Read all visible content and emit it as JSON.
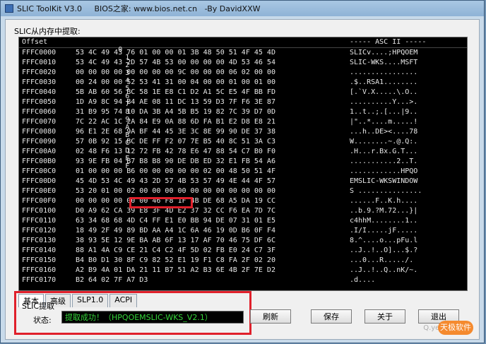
{
  "window": {
    "title": "SLIC ToolKit V3.0     BIOS之家: www.bios.net.cn   -By DavidXXW"
  },
  "memory_section": {
    "label": "SLIC从内存中提取:"
  },
  "hex_view": {
    "header": {
      "offset": "Offset",
      "cols": [
        "0",
        "1",
        "2",
        "3",
        "4",
        "5",
        "6",
        "7",
        "8",
        "9",
        "A",
        "B",
        "C",
        "D",
        "E",
        "F"
      ],
      "ascii": "----- ASC II -----"
    },
    "rows": [
      {
        "addr": "FFFC0000",
        "bytes": "53 4C 49 43 76 01 00 00 01 3B 48 50 51 4F 45 4D",
        "ascii": "SLICv....;HPQOEM"
      },
      {
        "addr": "FFFC0010",
        "bytes": "53 4C 49 43 2D 57 4B 53 00 00 00 00 4D 53 46 54",
        "ascii": "SLIC-WKS....MSFT"
      },
      {
        "addr": "FFFC0020",
        "bytes": "00 00 00 00 00 00 00 00 9C 00 00 00 06 02 00 00",
        "ascii": "................"
      },
      {
        "addr": "FFFC0030",
        "bytes": "00 24 00 00 52 53 41 31 00 04 00 00 01 00 01 00",
        "ascii": ".$..RSA1........"
      },
      {
        "addr": "FFFC0040",
        "bytes": "5B AB 60 56 BC 58 1E E8 C1 D2 A1 5C E5 4F BB FD",
        "ascii": "[.`V.X.....\\.O.."
      },
      {
        "addr": "FFFC0050",
        "bytes": "1D A9 8C 94 B4 AE 08 11 DC 13 59 D3 7F F6 3E 87",
        "ascii": "..........Y...>."
      },
      {
        "addr": "FFFC0060",
        "bytes": "31 B9 95 74 10 DA 3B A4 5B B5 19 82 7C 39 D7 0D",
        "ascii": "1..t..;.[...|9.."
      },
      {
        "addr": "FFFC0070",
        "bytes": "7C 22 AC 1C 2A 84 E9 0A 88 6D FA B1 E2 D8 E8 21",
        "ascii": "|\"..*....m.....!"
      },
      {
        "addr": "FFFC0080",
        "bytes": "96 E1 2E 68 9A BF 44 45 3E 3C 8E 99 90 DE 37 38",
        "ascii": "...h..DE><....78"
      },
      {
        "addr": "FFFC0090",
        "bytes": "57 0B 92 15 BC DE FF F2 07 7E B5 40 8C 51 3A C3",
        "ascii": "W........~.@.Q:."
      },
      {
        "addr": "FFFC00A0",
        "bytes": "02 48 F6 13 12 72 FB 42 78 E6 47 88 54 C7 B0 F0",
        "ascii": ".H...r.Bx.G.T..."
      },
      {
        "addr": "FFFC00B0",
        "bytes": "93 9E FB 04 B7 B8 B8 90 DE DB ED 32 E1 FB 54 A6",
        "ascii": "...........2..T."
      },
      {
        "addr": "FFFC00C0",
        "bytes": "01 00 00 00 B6 00 00 00 00 00 02 00 48 50 51 4F",
        "ascii": "............HPQO"
      },
      {
        "addr": "FFFC00D0",
        "bytes": "45 4D 53 4C 49 43 2D 57 4B 53 57 49 4E 44 4F 57",
        "ascii": "EMSLIC-WKSWINDOW"
      },
      {
        "addr": "FFFC00E0",
        "bytes": "53 20 01 00 02 00 00 00 00 00 00 00 00 00 00 00",
        "ascii": "S ..............."
      },
      {
        "addr": "FFFC00F0",
        "bytes": "00 00 00 00 00 00 46 F8 1F 4B DE 68 A5 DA 19 CC",
        "ascii": "......F..K.h...."
      },
      {
        "addr": "FFFC0100",
        "bytes": "D0 A9 62 CA 39 E8 3F 4D E2 37 32 CC F6 EA 7D 7C",
        "ascii": "..b.9.?M.72...}|"
      },
      {
        "addr": "FFFC0110",
        "bytes": "63 34 68 68 4D C4 FF E1 E0 BB 94 DE 07 31 01 E5",
        "ascii": "c4hhM........1.."
      },
      {
        "addr": "FFFC0120",
        "bytes": "18 49 2F 49 89 BD AA A4 1C 6A 46 19 0D B6 0F F4",
        "ascii": ".I/I.....jF....."
      },
      {
        "addr": "FFFC0130",
        "bytes": "38 93 5E 12 9E BA AB 6F 13 17 AF 70 46 75 DF 6C",
        "ascii": "8.^....o...pFu.l"
      },
      {
        "addr": "FFFC0140",
        "bytes": "88 A1 4A C9 CE 21 C4 C2 4F 5D 02 FB E0 24 C7 3F",
        "ascii": "..J..!..O]...$.?"
      },
      {
        "addr": "FFFC0150",
        "bytes": "B4 B0 D1 30 8F C9 82 52 E1 19 F1 C8 FA 2F 02 20",
        "ascii": "...0...R...../. "
      },
      {
        "addr": "FFFC0160",
        "bytes": "A2 B9 4A 01 DA 21 11 B7 51 A2 B3 6E 4B 2F 7E D2",
        "ascii": "..J..!..Q..nK/~."
      },
      {
        "addr": "FFFC0170",
        "bytes": "B2 64 02 7F A7 D3",
        "ascii": ".d...."
      }
    ]
  },
  "tabs": [
    "基本",
    "高级",
    "SLP1.0",
    "ACPI"
  ],
  "slic_extract": {
    "title": "SLIC提取",
    "status_label": "状态:",
    "status_value": "提取成功！（HPQOEMSLIC-WKS_V2.1）"
  },
  "buttons": {
    "refresh": "刷新",
    "save": "保存",
    "about": "关于",
    "exit": "退出"
  },
  "watermark": "Q.yesky.com",
  "corner_badge": "天极软件"
}
